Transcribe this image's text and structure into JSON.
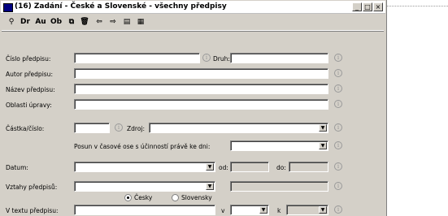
{
  "window": {
    "title": "(16) Zadání - České a Slovenské - všechny předpisy",
    "controls": {
      "minimize": "_",
      "maximize": "□",
      "close": "×"
    }
  },
  "toolbar": {
    "buttons": [
      {
        "name": "search-icon",
        "label": "⚲"
      },
      {
        "name": "dr-button",
        "label": "Dr"
      },
      {
        "name": "au-button",
        "label": "Au"
      },
      {
        "name": "ob-button",
        "label": "Ob"
      },
      {
        "name": "copy-icon",
        "label": "⧉"
      },
      {
        "name": "trash-icon",
        "label": "🗑"
      },
      {
        "name": "arrow-left-icon",
        "label": "⇦"
      },
      {
        "name": "arrow-right-icon",
        "label": "⇨"
      },
      {
        "name": "print-preview-icon",
        "label": "▤"
      },
      {
        "name": "save-icon",
        "label": "▦"
      }
    ]
  },
  "form": {
    "cislo_label": "Číslo předpisu:",
    "druh_label": "Druh:",
    "autor_label": "Autor předpisu:",
    "nazev_label": "Název předpisu:",
    "oblast_label": "Oblasti úpravy:",
    "castka_label": "Částka/číslo:",
    "zdroj_label": "Zdroj:",
    "posun_label": "Posun v časové ose s účinností právě ke dni:",
    "datum_label": "Datum:",
    "od_label": "od:",
    "do_label": "do:",
    "vztahy_label": "Vztahy předpisů:",
    "radio_cesky": "Česky",
    "radio_slovensky": "Slovensky",
    "text_label": "V textu předpisu:",
    "v_label": "v",
    "k_label": "k",
    "info_glyph": "i",
    "dropdown_glyph": "▼"
  }
}
